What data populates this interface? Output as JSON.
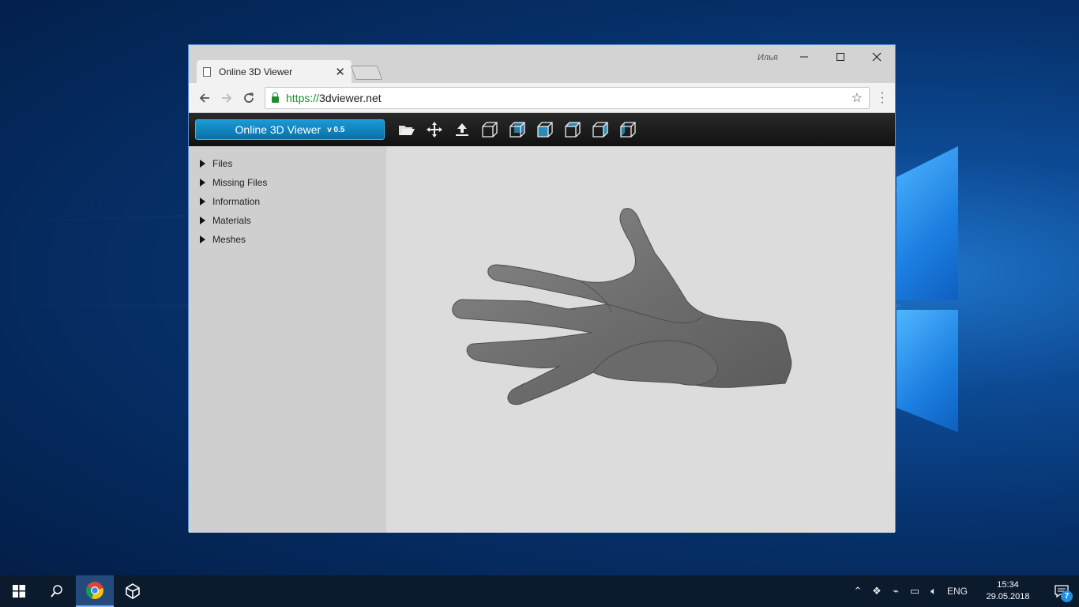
{
  "browser": {
    "tab_title": "Online 3D Viewer",
    "tab_close": "✕",
    "user_name": "Илья",
    "url_scheme": "https://",
    "url_host": "3dviewer.net"
  },
  "app": {
    "brand_name": "Online 3D Viewer",
    "brand_version": "v 0.5",
    "tools": [
      "open-folder-icon",
      "fit-view-icon",
      "upload-icon",
      "view-front-icon",
      "view-back-icon",
      "view-left-icon",
      "view-right-icon",
      "view-top-icon",
      "view-bottom-icon"
    ],
    "sidebar_items": [
      {
        "label": "Files"
      },
      {
        "label": "Missing Files"
      },
      {
        "label": "Information"
      },
      {
        "label": "Materials"
      },
      {
        "label": "Meshes"
      }
    ],
    "model": "hand-model"
  },
  "taskbar": {
    "language": "ENG",
    "time": "15:34",
    "date": "29.05.2018",
    "notification_count": "7"
  },
  "colors": {
    "accent": "#1a9ad6",
    "desktop": "#06306a"
  }
}
